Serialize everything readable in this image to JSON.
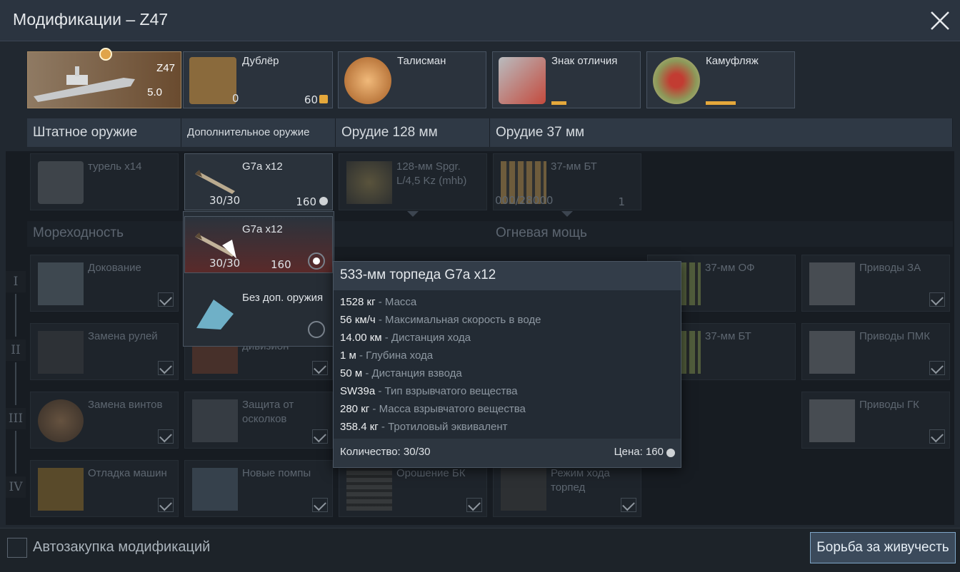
{
  "window": {
    "title": "Модификации – Z47"
  },
  "top_cards": {
    "ship": {
      "name": "Z47",
      "br": "5.0"
    },
    "crew": {
      "label": "Дублёр",
      "count": "0",
      "price": "60"
    },
    "talisman": {
      "label": "Талисман"
    },
    "decal": {
      "label": "Знак отличия",
      "progress": 0.1
    },
    "camo": {
      "label": "Камуфляж",
      "progress": 0.2
    }
  },
  "columns": {
    "standard": "Штатное оружие",
    "additional": "Дополнительное оружие",
    "gun128": "Орудие 128 мм",
    "gun37": "Орудие 37 мм"
  },
  "row0": {
    "turret": "турель х14",
    "torp": {
      "name": "G7a x12",
      "ammo": "30/30",
      "price": "160"
    },
    "shell128": "128-мм Spgr. L/4,5 Kz (mhb)",
    "shell37": {
      "name": "37-мм БТ",
      "ammo": "000/28000",
      "price": "1"
    }
  },
  "dropdown": {
    "opt1": {
      "name": "G7a x12",
      "ammo": "30/30",
      "price": "160"
    },
    "opt2": {
      "name": "Без доп. оружия"
    }
  },
  "sections": {
    "seaworthiness": "Мореходность",
    "firepower": "Огневая мощь"
  },
  "tiers": [
    "I",
    "II",
    "III",
    "IV"
  ],
  "mods": {
    "docking": "Докование",
    "rudders": "Замена рулей",
    "division": "дивизион",
    "props": "Замена винтов",
    "splinter": "Защита от осколков",
    "engine": "Отладка машин",
    "pumps": "Новые помпы",
    "irrigation": "Орошение БК",
    "torpmode": "Режим хода торпед",
    "of37": "37-мм ОФ",
    "bt37": "37-мм БТ",
    "aa_drive": "Приводы ЗА",
    "pmk_drive": "Приводы ПМК",
    "gk_drive": "Приводы ГК"
  },
  "tooltip": {
    "title": "533-мм торпеда G7a x12",
    "lines": [
      {
        "v": "1528 кг",
        "k": " - Масса"
      },
      {
        "v": "56 км/ч",
        "k": " - Максимальная скорость в воде"
      },
      {
        "v": "14.00 км",
        "k": " - Дистанция хода"
      },
      {
        "v": "1 м",
        "k": " - Глубина хода"
      },
      {
        "v": "50 м",
        "k": " - Дистанция взвода"
      },
      {
        "v": "SW39a",
        "k": " - Тип взрывчатого вещества"
      },
      {
        "v": "280 кг",
        "k": " - Масса взрывчатого вещества"
      },
      {
        "v": "358.4 кг",
        "k": " - Тротиловый эквивалент"
      }
    ],
    "qty": "Количество: 30/30",
    "price": "Цена: 160"
  },
  "bottom": {
    "auto_purchase": "Автозакупка модификаций",
    "damage_control": "Борьба за живучесть"
  },
  "colors": {
    "accent": "#e5a83b",
    "button_border": "#7fa6c8"
  }
}
